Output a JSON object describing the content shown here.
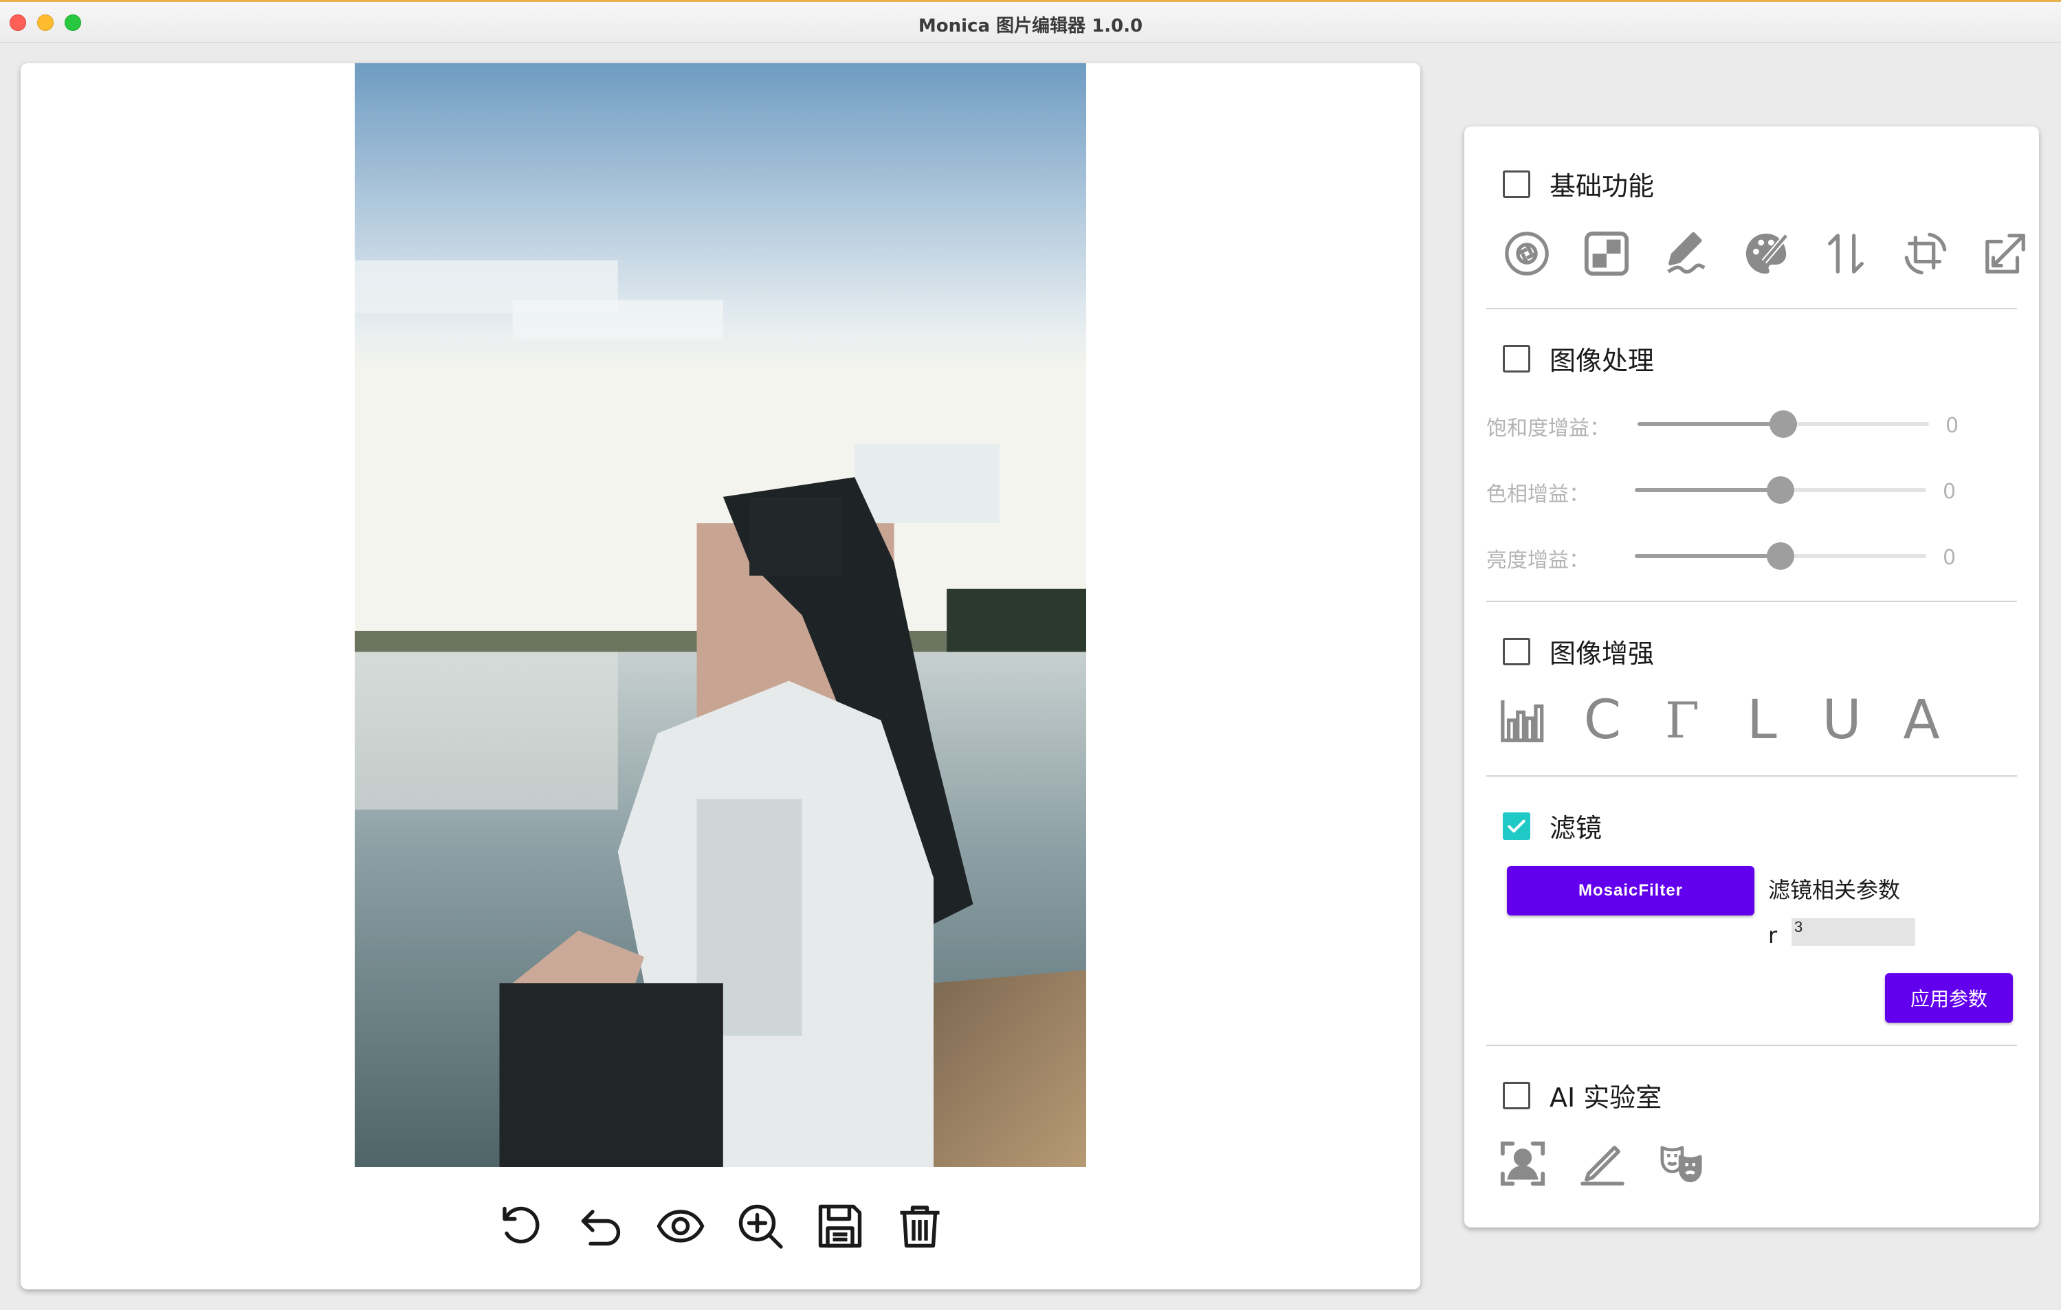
{
  "window": {
    "title": "Monica 图片编辑器 1.0.0"
  },
  "image_toolbar": {
    "icons": [
      "rotate-icon",
      "undo-icon",
      "preview-eye-icon",
      "zoom-in-icon",
      "save-icon",
      "delete-icon"
    ]
  },
  "panel": {
    "basic": {
      "title": "基础功能",
      "checked": false,
      "icons": [
        "aperture-icon",
        "mosaic-icon",
        "draw-icon",
        "color-palette-icon",
        "flip-icon",
        "crop-rotate-icon",
        "resize-icon"
      ]
    },
    "processing": {
      "title": "图像处理",
      "checked": false,
      "sliders": [
        {
          "label": "饱和度增益：",
          "value": "0",
          "level": 0.5
        },
        {
          "label": "色相增益：",
          "value": "0",
          "level": 0.5
        },
        {
          "label": "亮度增益：",
          "value": "0",
          "level": 0.5
        }
      ]
    },
    "enhance": {
      "title": "图像增强",
      "checked": false,
      "buttons": [
        "C",
        "Γ",
        "L",
        "U",
        "A"
      ],
      "icons": [
        "histogram-icon"
      ]
    },
    "filter": {
      "title": "滤镜",
      "checked": true,
      "selected_filter": "MosaicFilter",
      "params_label": "滤镜相关参数",
      "param_name": "r",
      "param_value": "3",
      "apply_label": "应用参数"
    },
    "ai": {
      "title": "AI 实验室",
      "checked": false,
      "icons": [
        "face-detect-icon",
        "sketch-pen-icon",
        "theater-masks-icon"
      ]
    }
  },
  "colors": {
    "accent": "#6200ee",
    "checkbox_checked": "#1ec9c6",
    "icon_gray": "#8a8a8a"
  }
}
